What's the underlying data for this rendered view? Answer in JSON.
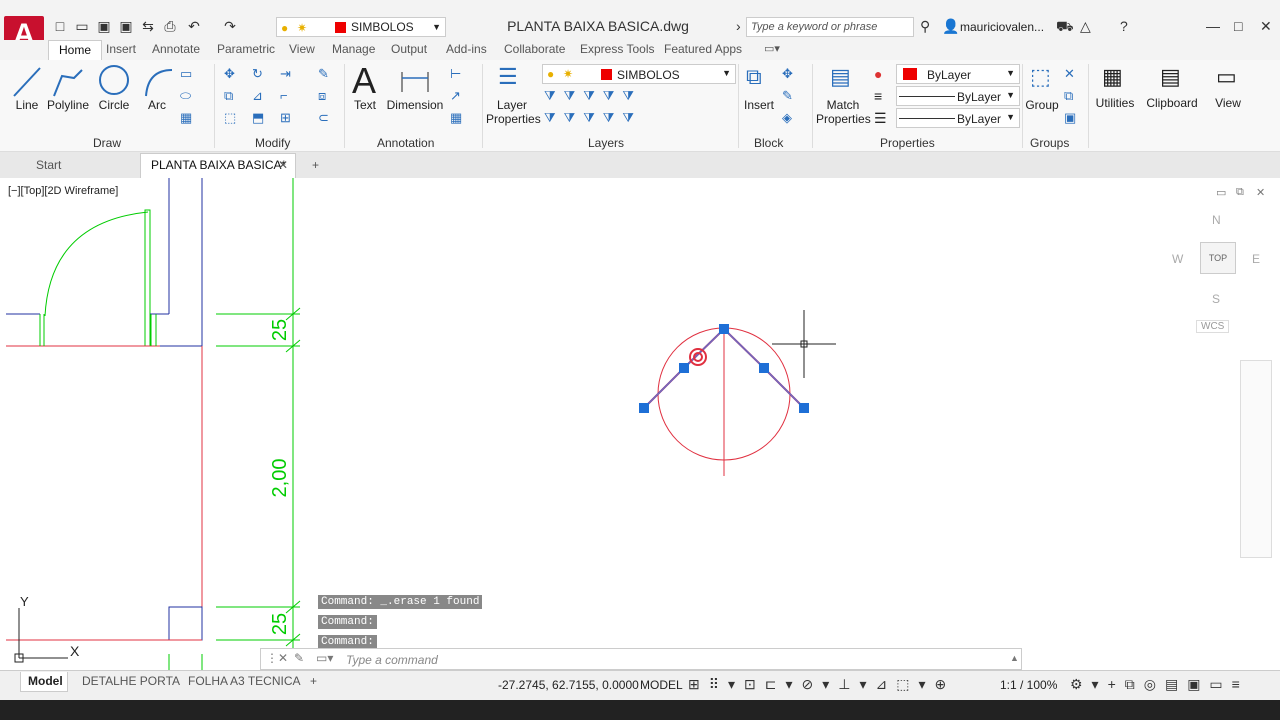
{
  "app": {
    "letter": "A",
    "title": "PLANTA BAIXA BASICA.dwg",
    "layer_qat": "SIMBOLOS",
    "search_placeholder": "Type a keyword or phrase",
    "user": "mauriciovalen..."
  },
  "menu": [
    "Home",
    "Insert",
    "Annotate",
    "Parametric",
    "View",
    "Manage",
    "Output",
    "Add-ins",
    "Collaborate",
    "Express Tools",
    "Featured Apps"
  ],
  "ribbon": {
    "draw": {
      "line": "Line",
      "polyline": "Polyline",
      "circle": "Circle",
      "arc": "Arc",
      "panel": "Draw"
    },
    "modify": {
      "panel": "Modify"
    },
    "annotation": {
      "text": "Text",
      "dimension": "Dimension",
      "panel": "Annotation"
    },
    "layers": {
      "layer_props_1": "Layer",
      "layer_props_2": "Properties",
      "current": "SIMBOLOS",
      "panel": "Layers"
    },
    "block": {
      "insert": "Insert",
      "panel": "Block"
    },
    "properties": {
      "match_1": "Match",
      "match_2": "Properties",
      "color": "ByLayer",
      "linetype": "ByLayer",
      "lineweight": "ByLayer",
      "panel": "Properties"
    },
    "groups": {
      "group": "Group",
      "panel": "Groups"
    },
    "utilities": "Utilities",
    "clipboard": "Clipboard",
    "view": "View"
  },
  "doc_tabs": {
    "start": "Start",
    "active": "PLANTA BAIXA BASICA*",
    "add": "+"
  },
  "viewport": {
    "label": "[−][Top][2D Wireframe]",
    "compass": {
      "n": "N",
      "s": "S",
      "e": "E",
      "w": "W",
      "top": "TOP",
      "wcs": "WCS"
    },
    "ucs_y": "Y",
    "ucs_x": "X"
  },
  "dims": {
    "d1": "25",
    "d2": "2,00",
    "d3": "25"
  },
  "commands": [
    "Command:  _.erase 1 found",
    "Command:",
    "Command:"
  ],
  "cmd_placeholder": "Type a command",
  "status": {
    "tabs": [
      "Model",
      "DETALHE PORTA",
      "FOLHA A3 TECNICA"
    ],
    "add": "+",
    "coords": "-27.2745, 62.7155, 0.0000",
    "model": "MODEL",
    "scale": "1:1 / 100%"
  },
  "colors": {
    "accent": "#c8102e",
    "grip": "#1e6fd6",
    "green": "#00cc00",
    "red": "#e03040",
    "blue": "#2030a0"
  }
}
